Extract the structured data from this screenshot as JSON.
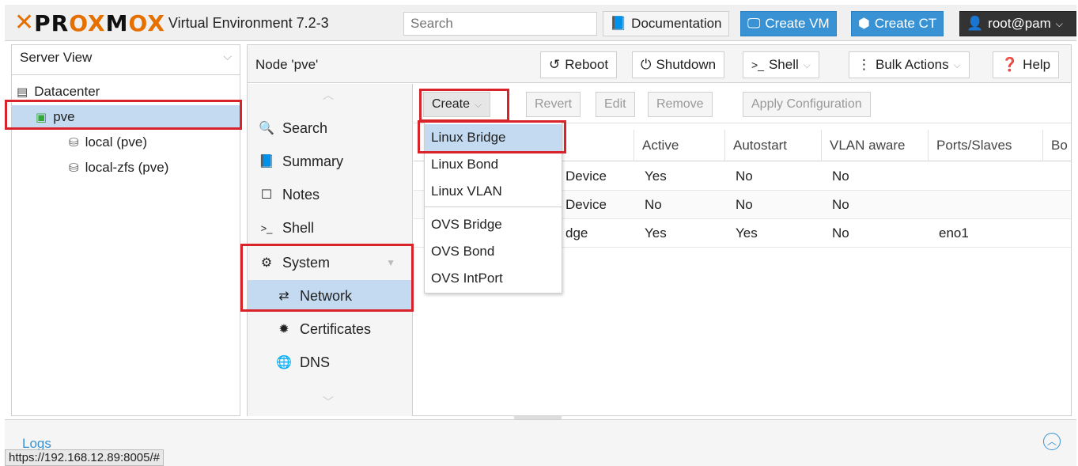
{
  "header": {
    "logo_text": "PROXMOX",
    "product_suffix": "Virtual Environment 7.2-3",
    "search_placeholder": "Search",
    "documentation_label": "Documentation",
    "create_vm_label": "Create VM",
    "create_ct_label": "Create CT",
    "user_label": "root@pam"
  },
  "tree": {
    "view_label": "Server View",
    "items": [
      {
        "label": "Datacenter",
        "icon": "datacenter-icon"
      },
      {
        "label": "pve",
        "icon": "node-online-icon"
      },
      {
        "label": "local (pve)",
        "icon": "storage-icon"
      },
      {
        "label": "local-zfs (pve)",
        "icon": "storage-icon"
      }
    ]
  },
  "node_header": {
    "title": "Node 'pve'",
    "reboot_label": "Reboot",
    "shutdown_label": "Shutdown",
    "shell_label": "Shell",
    "bulk_actions_label": "Bulk Actions",
    "help_label": "Help"
  },
  "nav": {
    "items": [
      {
        "label": "Search",
        "icon": "search-icon"
      },
      {
        "label": "Summary",
        "icon": "book-icon"
      },
      {
        "label": "Notes",
        "icon": "notes-icon"
      },
      {
        "label": "Shell",
        "icon": "terminal-icon"
      },
      {
        "label": "System",
        "icon": "cogs-icon"
      },
      {
        "label": "Network",
        "icon": "exchange-icon"
      },
      {
        "label": "Certificates",
        "icon": "certificate-icon"
      },
      {
        "label": "DNS",
        "icon": "globe-icon"
      }
    ]
  },
  "toolbar": {
    "create_label": "Create",
    "revert_label": "Revert",
    "edit_label": "Edit",
    "remove_label": "Remove",
    "apply_label": "Apply Configuration"
  },
  "grid": {
    "columns": [
      "Active",
      "Autostart",
      "VLAN aware",
      "Ports/Slaves",
      "Bo"
    ],
    "rows": [
      {
        "type": "Device",
        "active": "Yes",
        "autostart": "No",
        "vlan": "No",
        "ports": ""
      },
      {
        "type": "Device",
        "active": "No",
        "autostart": "No",
        "vlan": "No",
        "ports": ""
      },
      {
        "type": "dge",
        "active": "Yes",
        "autostart": "Yes",
        "vlan": "No",
        "ports": "eno1"
      }
    ]
  },
  "create_menu": {
    "items": [
      "Linux Bridge",
      "Linux Bond",
      "Linux VLAN",
      "OVS Bridge",
      "OVS Bond",
      "OVS IntPort"
    ],
    "highlighted": "Linux Bridge"
  },
  "footer": {
    "logs_label": "Logs",
    "status_url": "https://192.168.12.89:8005/#"
  },
  "colors": {
    "accent": "#3892d4",
    "brand_orange": "#e57000",
    "selection": "#c3daf0",
    "annotation_red": "#d9232a"
  }
}
